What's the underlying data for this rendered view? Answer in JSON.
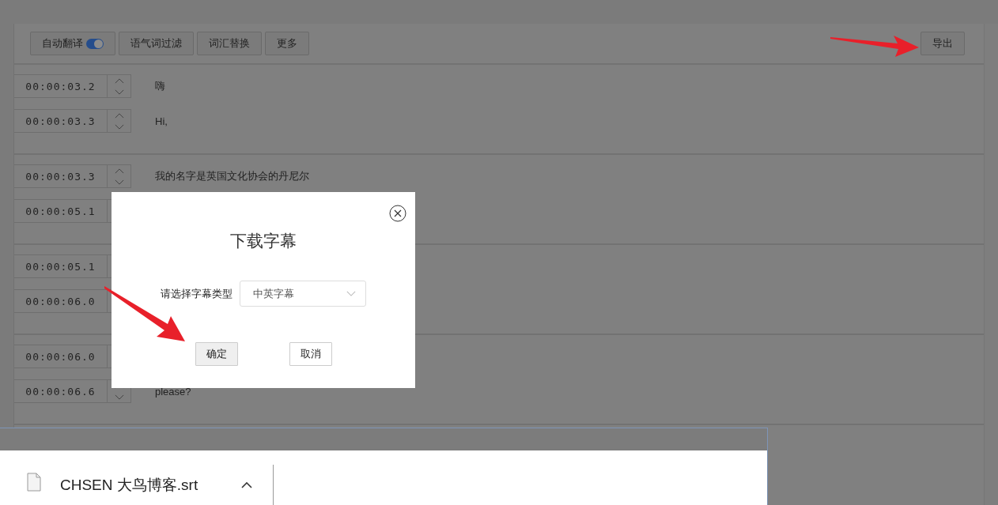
{
  "toolbar": {
    "buttons": [
      {
        "kind": "toggle",
        "label": "自动翻译",
        "on": true
      },
      {
        "kind": "button",
        "label": "语气词过滤"
      },
      {
        "kind": "button",
        "label": "词汇替换"
      },
      {
        "kind": "button",
        "label": "更多"
      }
    ],
    "export_button": "导出"
  },
  "segments": [
    {
      "rows": [
        {
          "time": "00:00:03.2",
          "text": "嗨"
        },
        {
          "time": "00:00:03.3",
          "text": "Hi,"
        }
      ]
    },
    {
      "rows": [
        {
          "time": "00:00:03.3",
          "text": "我的名字是英国文化协会的丹尼尔"
        },
        {
          "time": "00:00:05.1",
          "spinner_covered": true
        }
      ]
    },
    {
      "rows": [
        {
          "time": "00:00:05.1",
          "spinner_covered": true
        },
        {
          "time": "00:00:06.0"
        }
      ]
    },
    {
      "rows": [
        {
          "time": "00:00:06.0"
        },
        {
          "time": "00:00:06.6",
          "text": "please?"
        }
      ]
    }
  ],
  "dialog": {
    "title": "下载字幕",
    "field_label": "请选择字幕类型",
    "select_value": "中英字幕",
    "buttons": [
      {
        "kind": "primary",
        "label": "确定"
      },
      {
        "kind": "default",
        "label": "取消"
      }
    ]
  },
  "downloads": [
    {
      "filename": "CHSEN 大鸟博客.srt"
    }
  ]
}
